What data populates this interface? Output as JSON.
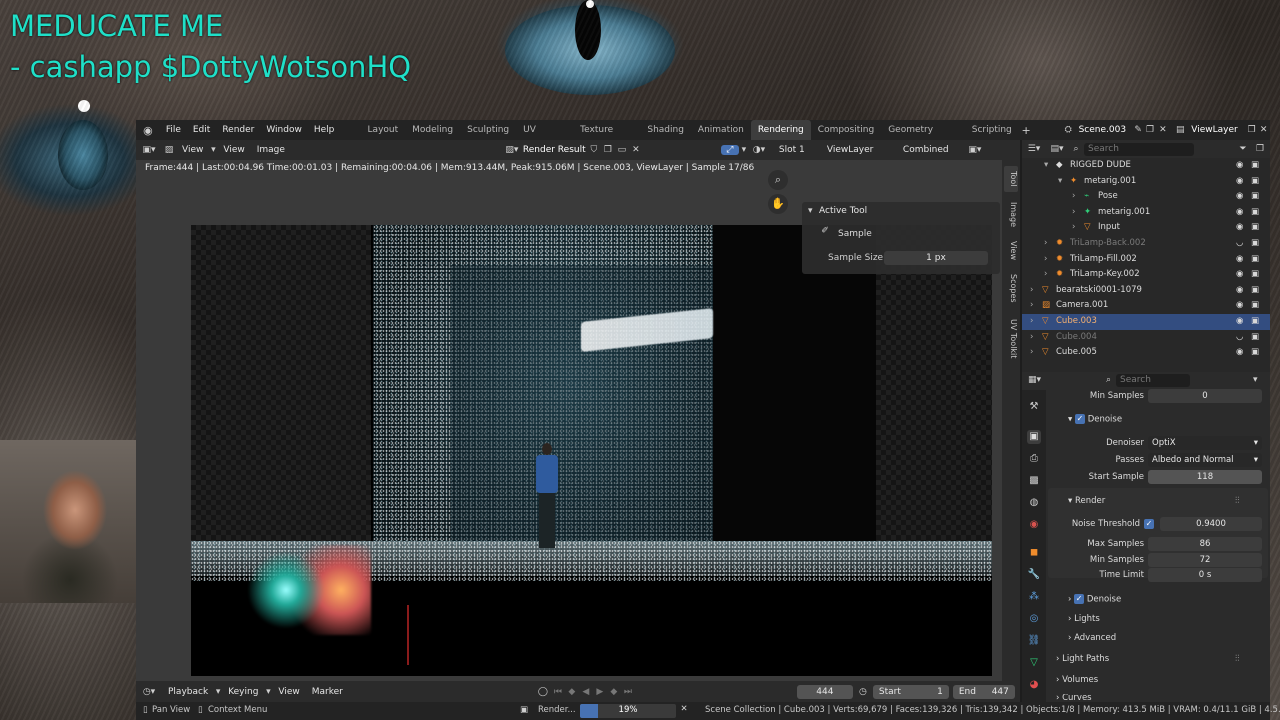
{
  "overlay": {
    "line1": "MEDUCATE ME",
    "line2": "- cashapp $DottyWotsonHQ"
  },
  "menu": [
    "File",
    "Edit",
    "Render",
    "Window",
    "Help"
  ],
  "workspaces": [
    "Layout",
    "Modeling",
    "Sculpting",
    "UV Editing",
    "Texture Paint",
    "Shading",
    "Animation",
    "Rendering",
    "Compositing",
    "Geometry Nodes",
    "Scripting"
  ],
  "active_workspace": "Rendering",
  "scene_name": "Scene.003",
  "view_layer": "ViewLayer",
  "image_editor": {
    "view": "View",
    "view2": "View",
    "image": "Image",
    "image_name": "Render Result",
    "slot": "Slot 1",
    "layer": "ViewLayer",
    "pass": "Combined",
    "stats": "Frame:444 | Last:00:04.96 Time:00:01.03 | Remaining:00:04.06 | Mem:913.44M, Peak:915.06M | Scene.003, ViewLayer | Sample 17/86",
    "tabs": [
      "Tool",
      "Image",
      "View",
      "Scopes",
      "UV Toolkit"
    ]
  },
  "active_tool": {
    "title": "Active Tool",
    "tool": "Sample",
    "size_label": "Sample Size",
    "size_value": "1 px"
  },
  "timeline": {
    "playback": "Playback",
    "keying": "Keying",
    "view": "View",
    "marker": "Marker",
    "frame": "444",
    "start_label": "Start",
    "start": "1",
    "end_label": "End",
    "end": "447"
  },
  "status": {
    "pan": "Pan View",
    "context": "Context Menu",
    "render": "Render...",
    "progress": "19%",
    "progress_fraction": 0.19,
    "info": "Scene Collection | Cube.003 | Verts:69,679 | Faces:139,326 | Tris:139,342 | Objects:1/8 | Memory: 413.5 MiB | VRAM: 0.4/11.1 GiB | 4.5.2"
  },
  "outliner": {
    "search": "Search",
    "rows": [
      {
        "name": "RIGGED DUDE",
        "indent": 1
      },
      {
        "name": "metarig.001",
        "indent": 2
      },
      {
        "name": "Pose",
        "indent": 3
      },
      {
        "name": "metarig.001",
        "indent": 3
      },
      {
        "name": "Input",
        "indent": 3
      },
      {
        "name": "TriLamp-Back.002",
        "indent": 1,
        "dim": true
      },
      {
        "name": "TriLamp-Fill.002",
        "indent": 1
      },
      {
        "name": "TriLamp-Key.002",
        "indent": 1
      },
      {
        "name": "bearatski0001-1079",
        "indent": 0
      },
      {
        "name": "Camera.001",
        "indent": 0
      },
      {
        "name": "Cube.003",
        "indent": 0,
        "selected": true
      },
      {
        "name": "Cube.004",
        "indent": 0,
        "dim": true
      },
      {
        "name": "Cube.005",
        "indent": 0
      }
    ]
  },
  "properties": {
    "search": "Search",
    "min_samples_top_label": "Min Samples",
    "min_samples_top": "0",
    "denoise_label": "Denoise",
    "denoiser_label": "Denoiser",
    "denoiser": "OptiX",
    "passes_label": "Passes",
    "passes": "Albedo and Normal",
    "start_sample_label": "Start Sample",
    "start_sample": "118",
    "render_panel": "Render",
    "noise_threshold_label": "Noise Threshold",
    "noise_threshold": "0.9400",
    "max_samples_label": "Max Samples",
    "max_samples": "86",
    "min_samples_label": "Min Samples",
    "min_samples": "72",
    "time_limit_label": "Time Limit",
    "time_limit": "0 s",
    "denoise2_label": "Denoise",
    "lights": "Lights",
    "advanced": "Advanced",
    "light_paths": "Light Paths",
    "volumes": "Volumes",
    "curves": "Curves"
  }
}
